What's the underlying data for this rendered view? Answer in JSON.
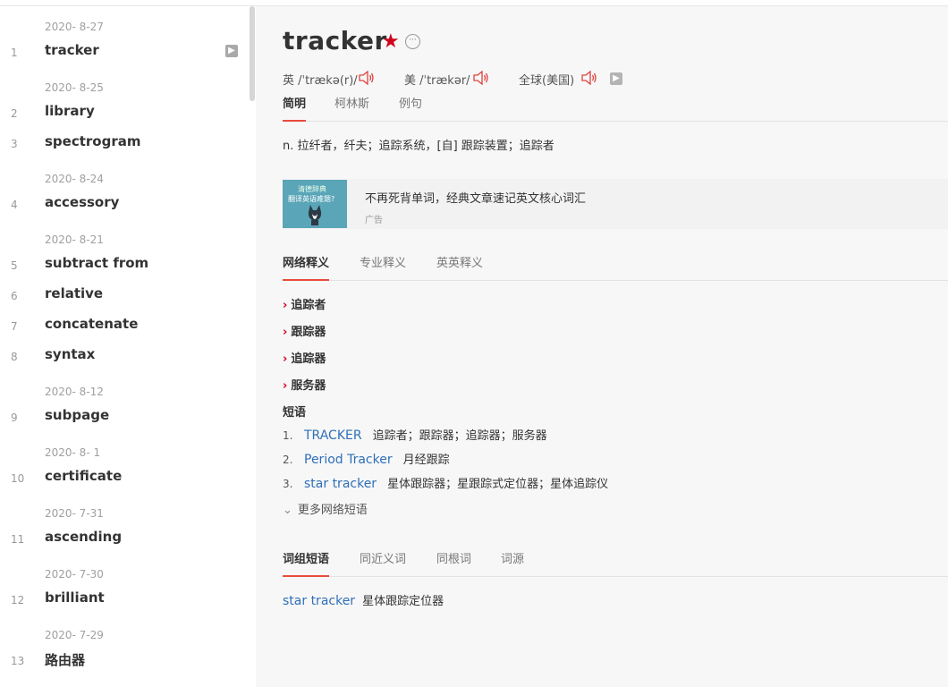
{
  "sidebar": {
    "dates": [
      "2020- 8-27",
      "2020- 8-25",
      "2020- 8-24",
      "2020- 8-21",
      "2020- 8-12",
      "2020- 8- 1",
      "2020- 7-31",
      "2020- 7-30",
      "2020- 7-29"
    ],
    "items": [
      {
        "num": "1",
        "word": "tracker"
      },
      {
        "num": "2",
        "word": "library"
      },
      {
        "num": "3",
        "word": "spectrogram"
      },
      {
        "num": "4",
        "word": "accessory"
      },
      {
        "num": "5",
        "word": "subtract from"
      },
      {
        "num": "6",
        "word": "relative"
      },
      {
        "num": "7",
        "word": "concatenate"
      },
      {
        "num": "8",
        "word": "syntax"
      },
      {
        "num": "9",
        "word": "subpage"
      },
      {
        "num": "10",
        "word": "certificate"
      },
      {
        "num": "11",
        "word": "ascending"
      },
      {
        "num": "12",
        "word": "brilliant"
      },
      {
        "num": "13",
        "word": "路由器"
      }
    ]
  },
  "entry": {
    "word": "tracker",
    "star": "★",
    "more": "···",
    "pronunciations": [
      {
        "label": "英 /ˈtrækə(r)/"
      },
      {
        "label": "美 /ˈtrækər/"
      },
      {
        "label": "全球(美国)"
      }
    ],
    "tabs1": [
      "简明",
      "柯林斯",
      "例句"
    ],
    "definition": "n. 拉纤者，纤夫；追踪系统，[自] 跟踪装置；追踪者"
  },
  "ad": {
    "image_line1": "清德辞典",
    "image_line2": "翻译英语难题?",
    "text": "不再死背单词，经典文章速记英文核心词汇",
    "tag": "广告"
  },
  "tabs2": [
    "网络释义",
    "专业释义",
    "英英释义"
  ],
  "net_translations": [
    "追踪者",
    "跟踪器",
    "追踪器",
    "服务器"
  ],
  "phrases_title": "短语",
  "phrases": [
    {
      "num": "1.",
      "en": "TRACKER",
      "zh": "追踪者；跟踪器；追踪器；服务器"
    },
    {
      "num": "2.",
      "en": "Period Tracker",
      "zh": "月经跟踪"
    },
    {
      "num": "3.",
      "en": "star tracker",
      "zh": "星体跟踪器；星跟踪式定位器；星体追踪仪"
    }
  ],
  "more_phrases": "更多网络短语",
  "tabs3": [
    "词组短语",
    "同近义词",
    "同根词",
    "词源"
  ],
  "bottom_phrase": {
    "en": "star tracker",
    "zh": "星体跟踪定位器"
  },
  "colors": {
    "accent": "#d0021b",
    "link": "#2f6fb8",
    "tab_underline": "#e74c3c"
  },
  "icons": {
    "speaker": "speaker-icon",
    "arrow": "arrow-right-icon",
    "star": "star-icon",
    "chevron": "chevron-right-icon"
  }
}
